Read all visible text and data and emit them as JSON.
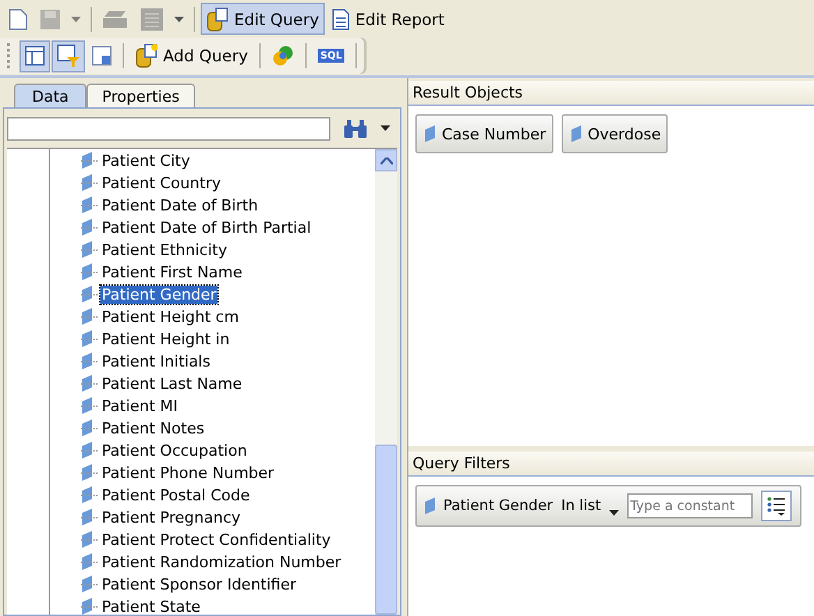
{
  "toolbar": {
    "buttons": [
      {
        "kind": "new",
        "pressed": false
      },
      {
        "kind": "save",
        "pressed": false,
        "disabled": true
      },
      {
        "kind": "caret",
        "pressed": false,
        "disabled": true
      },
      {
        "kind": "print",
        "pressed": false,
        "disabled": true
      },
      {
        "kind": "layout",
        "pressed": false,
        "disabled": true
      },
      {
        "kind": "caret",
        "pressed": false,
        "disabled": false
      },
      {
        "kind": "query",
        "label": "Edit Query",
        "pressed": true
      },
      {
        "kind": "report",
        "label": "Edit Report",
        "pressed": false
      }
    ]
  },
  "query_toolbar": {
    "buttons": [
      {
        "kind": "panel",
        "pressed": true
      },
      {
        "kind": "filter",
        "pressed": true
      },
      {
        "kind": "grid",
        "pressed": false
      },
      {
        "kind": "addquery",
        "label": "Add Query",
        "pressed": false
      },
      {
        "kind": "combined",
        "pressed": false
      },
      {
        "kind": "sql",
        "label": "SQL",
        "pressed": false
      }
    ]
  },
  "tabs": [
    {
      "label": "Data",
      "selected": true
    },
    {
      "label": "Properties",
      "selected": false
    }
  ],
  "tree": {
    "items": [
      {
        "label": "Patient City",
        "selected": false
      },
      {
        "label": "Patient Country",
        "selected": false
      },
      {
        "label": "Patient Date of Birth",
        "selected": false
      },
      {
        "label": "Patient Date of Birth Partial",
        "selected": false
      },
      {
        "label": "Patient Ethnicity",
        "selected": false
      },
      {
        "label": "Patient First Name",
        "selected": false
      },
      {
        "label": "Patient Gender",
        "selected": true
      },
      {
        "label": "Patient Height cm",
        "selected": false
      },
      {
        "label": "Patient Height in",
        "selected": false
      },
      {
        "label": "Patient Initials",
        "selected": false
      },
      {
        "label": "Patient Last Name",
        "selected": false
      },
      {
        "label": "Patient MI",
        "selected": false
      },
      {
        "label": "Patient Notes",
        "selected": false
      },
      {
        "label": "Patient Occupation",
        "selected": false
      },
      {
        "label": "Patient Phone Number",
        "selected": false
      },
      {
        "label": "Patient Postal Code",
        "selected": false
      },
      {
        "label": "Patient Pregnancy",
        "selected": false
      },
      {
        "label": "Patient Protect Confidentiality",
        "selected": false
      },
      {
        "label": "Patient Randomization Number",
        "selected": false
      },
      {
        "label": "Patient Sponsor Identifier",
        "selected": false
      },
      {
        "label": "Patient State",
        "selected": false
      }
    ]
  },
  "result_objects": {
    "title": "Result Objects",
    "items": [
      "Case Number",
      "Overdose"
    ]
  },
  "query_filters": {
    "title": "Query Filters",
    "filter": {
      "object": "Patient Gender",
      "operator": "In list",
      "placeholder": "Type a constant"
    }
  }
}
